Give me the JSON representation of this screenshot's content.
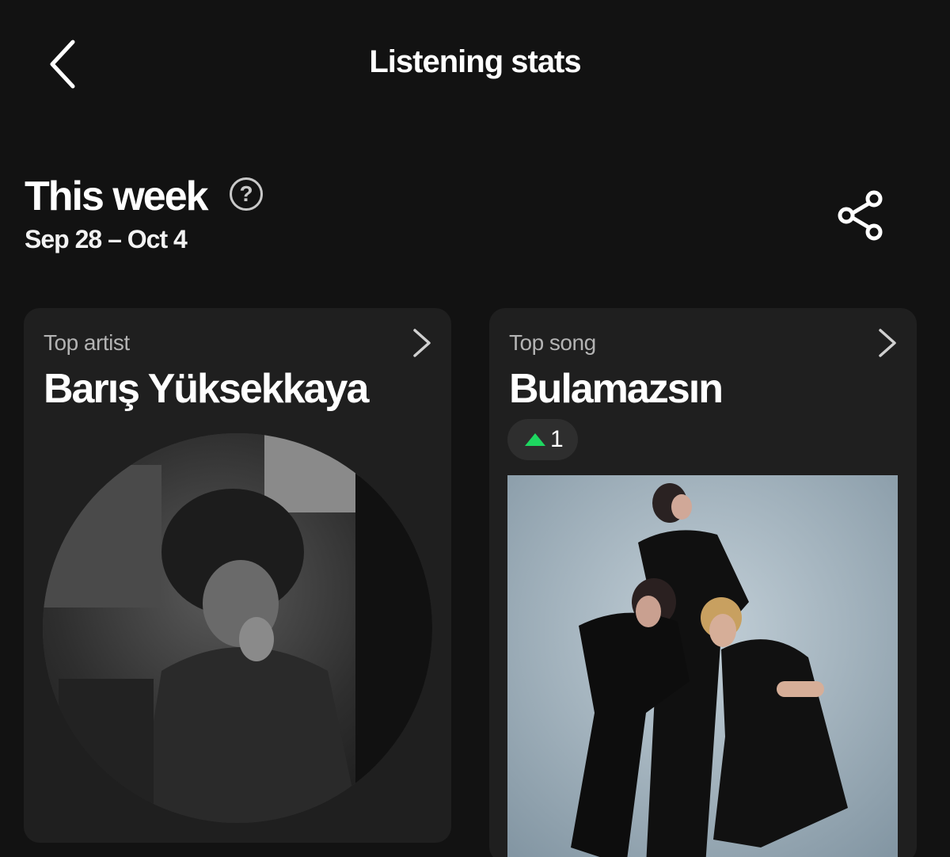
{
  "header": {
    "title": "Listening stats",
    "back_icon": "chevron-left-icon"
  },
  "section": {
    "title": "This week",
    "help_icon": "question-mark-icon",
    "help_glyph": "?",
    "date_range": "Sep 28 – Oct 4",
    "share_icon": "share-icon"
  },
  "cards": {
    "artist": {
      "label": "Top artist",
      "name": "Barış Yüksekkaya",
      "image": "artist-photo"
    },
    "song": {
      "label": "Top song",
      "name": "Bulamazsın",
      "rank_change": "1",
      "rank_icon": "arrow-up-icon",
      "image": "song-cover"
    }
  },
  "colors": {
    "background": "#121212",
    "card": "#1f1f1f",
    "accent_green": "#1ed760",
    "muted_text": "#b3b3b3"
  }
}
